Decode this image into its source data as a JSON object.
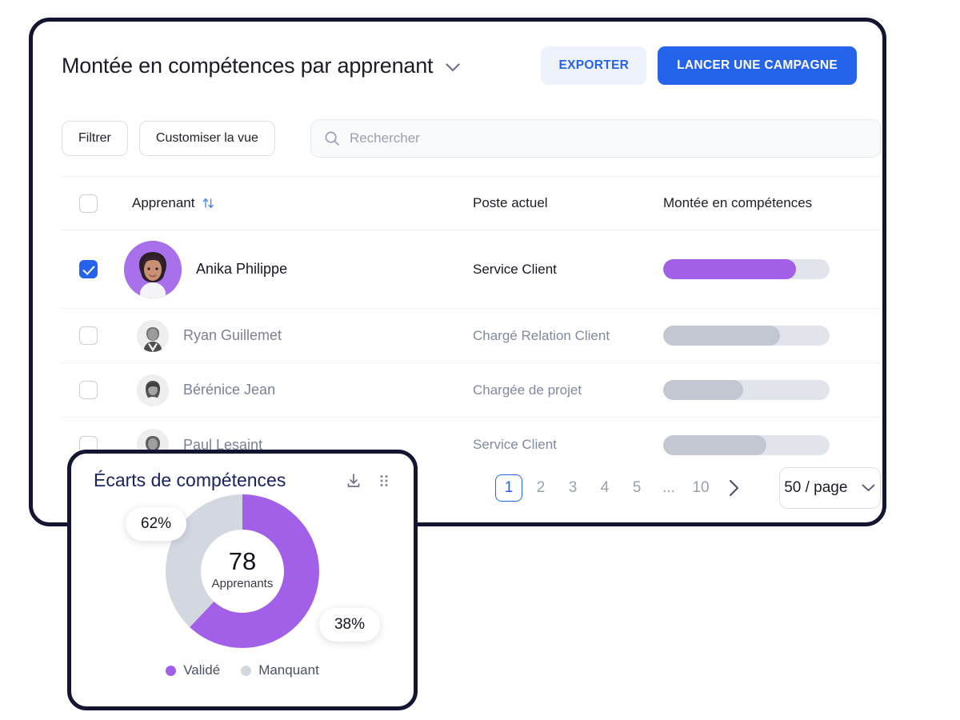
{
  "header": {
    "title": "Montée en compétences par apprenant",
    "title_dropdown_icon": "chevron-down-icon",
    "export_label": "EXPORTER",
    "campaign_label": "LANCER UNE CAMPAGNE"
  },
  "toolbar": {
    "filter_label": "Filtrer",
    "customize_label": "Customiser la vue",
    "search_placeholder": "Rechercher",
    "search_value": "",
    "search_icon": "search-icon"
  },
  "table": {
    "columns": [
      "Apprenant",
      "Poste actuel",
      "Montée en compétences"
    ],
    "sort_icon": "sort-arrows-icon",
    "header_checkbox_checked": false,
    "rows": [
      {
        "name": "Anika Philippe",
        "role": "Service Client",
        "progress": 80,
        "selected": true,
        "avatar": "avatar-anika"
      },
      {
        "name": "Ryan Guillemet",
        "role": "Chargé Relation Client",
        "progress": 70,
        "selected": false,
        "avatar": "avatar-ryan"
      },
      {
        "name": "Bérénice Jean",
        "role": "Chargée de projet",
        "progress": 48,
        "selected": false,
        "avatar": "avatar-berenice"
      },
      {
        "name": "Paul Lesaint",
        "role": "Service Client",
        "progress": 62,
        "selected": false,
        "avatar": "avatar-paul"
      }
    ]
  },
  "pagination": {
    "pages": [
      "1",
      "2",
      "3",
      "4",
      "5",
      "...",
      "10"
    ],
    "current": "1",
    "next_icon": "chevron-right-icon",
    "per_page_label": "50 / page",
    "per_page_icon": "chevron-down-icon"
  },
  "donut_card": {
    "title": "Écarts de compétences",
    "download_icon": "download-icon",
    "drag_icon": "drag-handle-icon",
    "center_value": "78",
    "center_label": "Apprenants",
    "bubble_primary": "62%",
    "bubble_secondary": "38%"
  },
  "chart_data": {
    "type": "pie",
    "title": "Écarts de compétences",
    "center_value": "78",
    "center_label": "Apprenants",
    "categories": [
      "Validé",
      "Manquant"
    ],
    "values": [
      62,
      38
    ],
    "value_labels": [
      "62%",
      "38%"
    ],
    "colors": [
      "#a25fe8",
      "#d3d7e0"
    ],
    "legend_position": "bottom",
    "donut": true
  },
  "colors": {
    "accent_blue": "#2563eb",
    "accent_purple": "#a25fe8",
    "bar_track": "#e1e4ea",
    "bar_muted": "#c2c7d2",
    "card_border": "#141433",
    "title_navy": "#1b2260"
  }
}
